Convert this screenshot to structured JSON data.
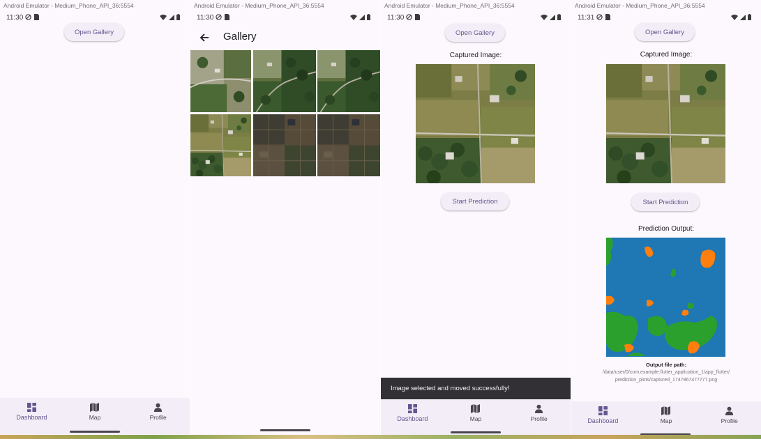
{
  "window_title": "Android Emulator - Medium_Phone_API_36:5554",
  "screens": [
    {
      "time": "11:30"
    },
    {
      "time": "11:30"
    },
    {
      "time": "11:30"
    },
    {
      "time": "11:31"
    }
  ],
  "open_gallery_label": "Open Gallery",
  "gallery_title": "Gallery",
  "captured_image_label": "Captured Image:",
  "start_prediction_label": "Start Prediction",
  "prediction_output_label": "Prediction Output:",
  "snackbar_text": "Image selected and moved successfully!",
  "output_path_label": "Output file path:",
  "output_path_value": "/data/user/0/com.example.flutter_application_1/app_flutter/ prediction_plots/captured_1747867477777.png",
  "nav": {
    "dashboard": "Dashboard",
    "map": "Map",
    "profile": "Profile"
  },
  "icons": {
    "status_left": [
      "do-not-disturb-icon",
      "sim-card-icon"
    ],
    "status_right": [
      "wifi-icon",
      "signal-icon",
      "battery-icon"
    ],
    "nav": [
      "dashboard-icon",
      "map-icon",
      "person-icon"
    ],
    "back": "arrow-back-icon"
  },
  "colors": {
    "app_background": "#fdf7fe",
    "surface_container": "#f3edf7",
    "primary": "#65558f",
    "snackbar": "#322f35",
    "mask_water_class": "#1f77b4",
    "mask_green_class": "#2ca02c",
    "mask_orange_class": "#ff7f0e"
  }
}
